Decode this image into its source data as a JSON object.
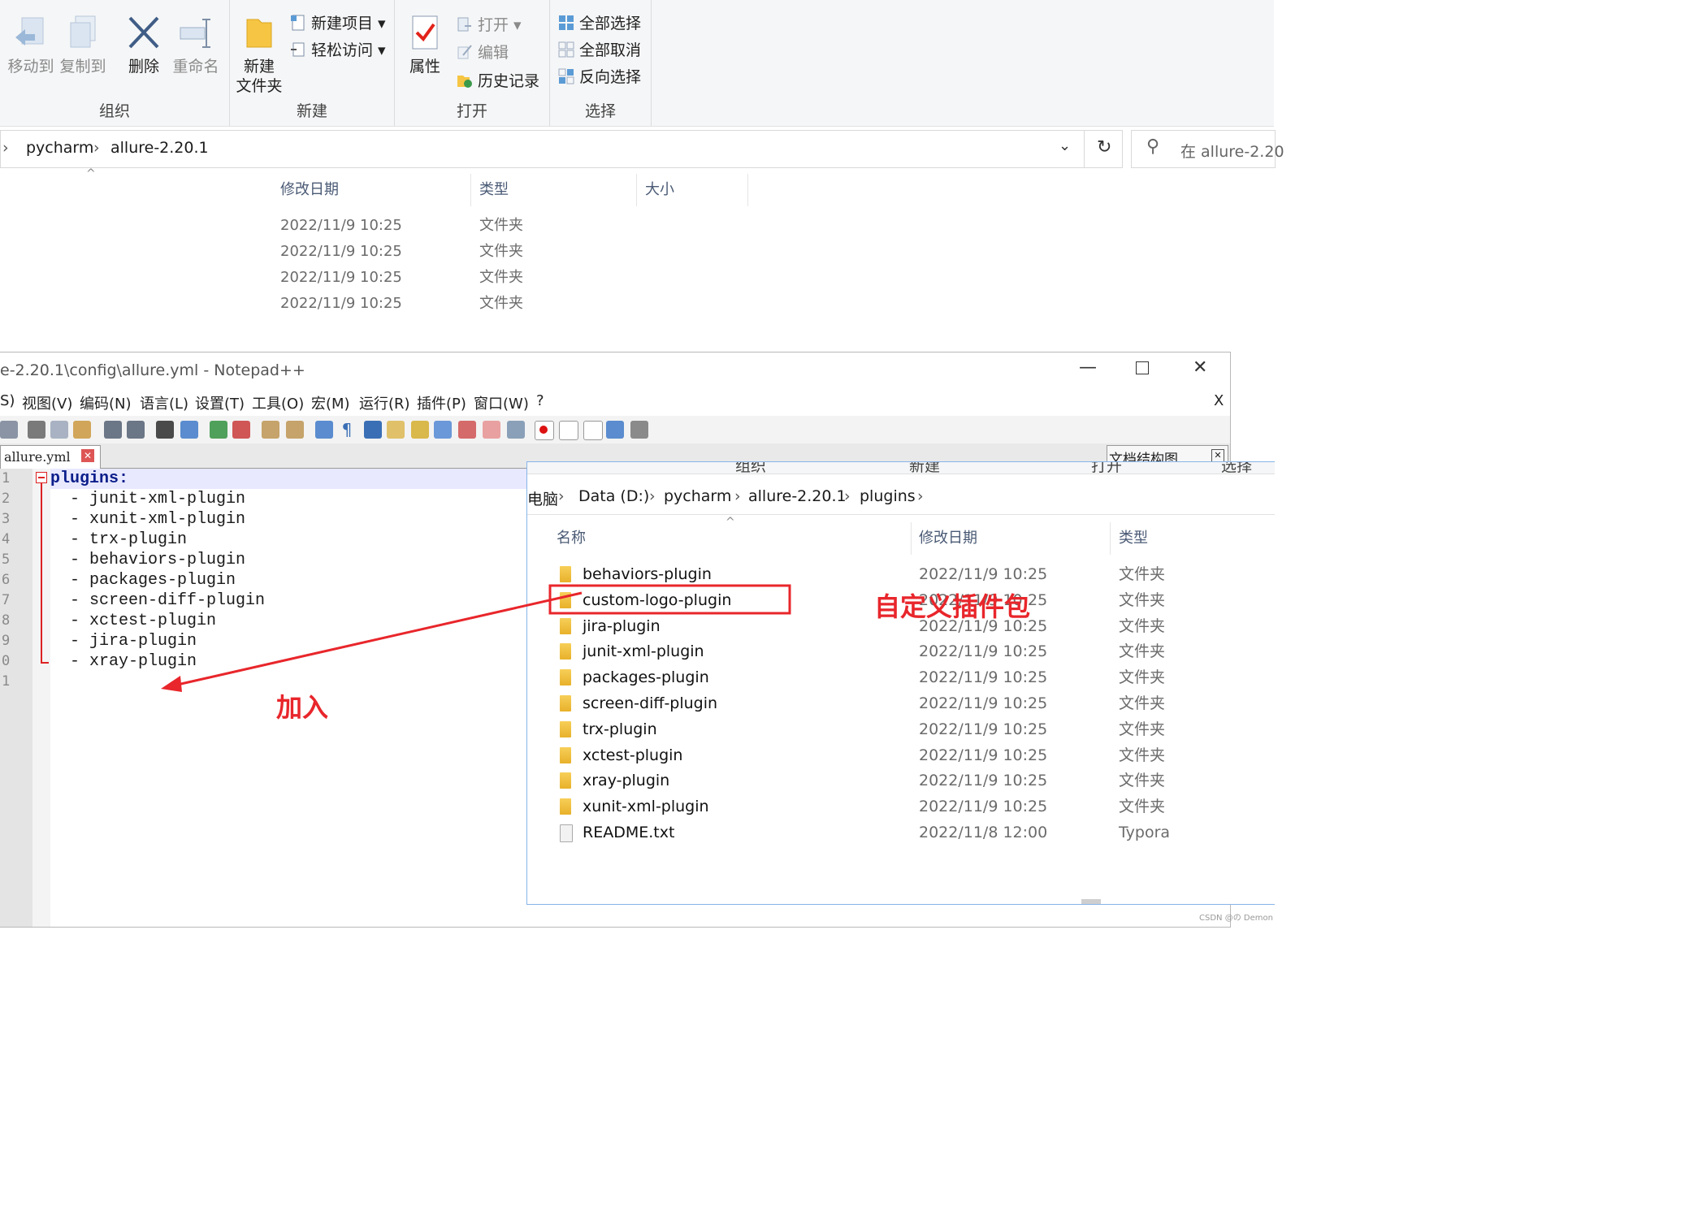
{
  "explorer_bg": {
    "ribbon": {
      "organize": {
        "caption": "组织",
        "move_to": "移动到",
        "copy_to": "复制到",
        "delete": "删除",
        "rename": "重命名"
      },
      "new": {
        "caption": "新建",
        "new_folder_l1": "新建",
        "new_folder_l2": "文件夹",
        "new_item": "新建项目",
        "easy_access": "轻松访问"
      },
      "open": {
        "caption": "打开",
        "properties": "属性",
        "open": "打开",
        "edit": "编辑",
        "history": "历史记录"
      },
      "select": {
        "caption": "选择",
        "select_all": "全部选择",
        "select_none": "全部取消",
        "invert": "反向选择"
      }
    },
    "address": {
      "crumbs": [
        "pycharm",
        "allure-2.20.1"
      ]
    },
    "search_placeholder": "在 allure-2.20",
    "columns": {
      "date": "修改日期",
      "type": "类型",
      "size": "大小"
    },
    "rows": [
      {
        "date": "2022/11/9 10:25",
        "type": "文件夹"
      },
      {
        "date": "2022/11/9 10:25",
        "type": "文件夹"
      },
      {
        "date": "2022/11/9 10:25",
        "type": "文件夹"
      },
      {
        "date": "2022/11/9 10:25",
        "type": "文件夹"
      }
    ]
  },
  "notepad": {
    "title": "e-2.20.1\\config\\allure.yml - Notepad++",
    "menu": [
      "S)",
      "视图(V)",
      "编码(N)",
      "语言(L)",
      "设置(T)",
      "工具(O)",
      "宏(M)",
      "运行(R)",
      "插件(P)",
      "窗口(W)",
      "?"
    ],
    "menu_close": "X",
    "tab": "allure.yml",
    "doc_map_title": "文档结构图",
    "lines": [
      {
        "n": "1",
        "text": "plugins:"
      },
      {
        "n": "2",
        "text": "  - junit-xml-plugin"
      },
      {
        "n": "3",
        "text": "  - xunit-xml-plugin"
      },
      {
        "n": "4",
        "text": "  - trx-plugin"
      },
      {
        "n": "5",
        "text": "  - behaviors-plugin"
      },
      {
        "n": "6",
        "text": "  - packages-plugin"
      },
      {
        "n": "7",
        "text": "  - screen-diff-plugin"
      },
      {
        "n": "8",
        "text": "  - xctest-plugin"
      },
      {
        "n": "9",
        "text": "  - jira-plugin"
      },
      {
        "n": "0",
        "text": "  - xray-plugin"
      },
      {
        "n": "1",
        "text": ""
      }
    ]
  },
  "explorer_fg": {
    "ribbon_partial": [
      "组织",
      "新建",
      "打开",
      "选择"
    ],
    "crumbs": [
      "电脑",
      "Data (D:)",
      "pycharm",
      "allure-2.20.1",
      "plugins"
    ],
    "columns": {
      "name": "名称",
      "date": "修改日期",
      "type": "类型"
    },
    "files": [
      {
        "name": "behaviors-plugin",
        "date": "2022/11/9 10:25",
        "type": "文件夹",
        "kind": "folder"
      },
      {
        "name": "custom-logo-plugin",
        "date": "2022/11/9 10:25",
        "type": "文件夹",
        "kind": "folder"
      },
      {
        "name": "jira-plugin",
        "date": "2022/11/9 10:25",
        "type": "文件夹",
        "kind": "folder"
      },
      {
        "name": "junit-xml-plugin",
        "date": "2022/11/9 10:25",
        "type": "文件夹",
        "kind": "folder"
      },
      {
        "name": "packages-plugin",
        "date": "2022/11/9 10:25",
        "type": "文件夹",
        "kind": "folder"
      },
      {
        "name": "screen-diff-plugin",
        "date": "2022/11/9 10:25",
        "type": "文件夹",
        "kind": "folder"
      },
      {
        "name": "trx-plugin",
        "date": "2022/11/9 10:25",
        "type": "文件夹",
        "kind": "folder"
      },
      {
        "name": "xctest-plugin",
        "date": "2022/11/9 10:25",
        "type": "文件夹",
        "kind": "folder"
      },
      {
        "name": "xray-plugin",
        "date": "2022/11/9 10:25",
        "type": "文件夹",
        "kind": "folder"
      },
      {
        "name": "xunit-xml-plugin",
        "date": "2022/11/9 10:25",
        "type": "文件夹",
        "kind": "folder"
      },
      {
        "name": "README.txt",
        "date": "2022/11/8 12:00",
        "type": "Typora",
        "kind": "markdown"
      }
    ]
  },
  "annotations": {
    "custom_label": "自定义插件包",
    "add_label": "加入",
    "color": "#e8262b"
  },
  "watermark": "CSDN @の Demon"
}
